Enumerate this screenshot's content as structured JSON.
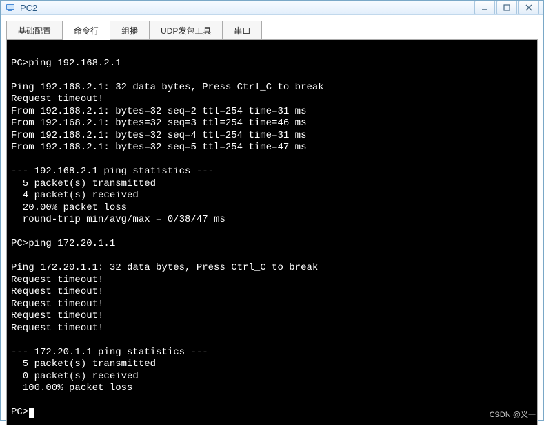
{
  "window": {
    "title": "PC2"
  },
  "tabs": [
    {
      "label": "基础配置",
      "active": false
    },
    {
      "label": "命令行",
      "active": true
    },
    {
      "label": "组播",
      "active": false
    },
    {
      "label": "UDP发包工具",
      "active": false
    },
    {
      "label": "串口",
      "active": false
    }
  ],
  "terminal": {
    "lines": [
      "",
      "PC>ping 192.168.2.1",
      "",
      "Ping 192.168.2.1: 32 data bytes, Press Ctrl_C to break",
      "Request timeout!",
      "From 192.168.2.1: bytes=32 seq=2 ttl=254 time=31 ms",
      "From 192.168.2.1: bytes=32 seq=3 ttl=254 time=46 ms",
      "From 192.168.2.1: bytes=32 seq=4 ttl=254 time=31 ms",
      "From 192.168.2.1: bytes=32 seq=5 ttl=254 time=47 ms",
      "",
      "--- 192.168.2.1 ping statistics ---",
      "  5 packet(s) transmitted",
      "  4 packet(s) received",
      "  20.00% packet loss",
      "  round-trip min/avg/max = 0/38/47 ms",
      "",
      "PC>ping 172.20.1.1",
      "",
      "Ping 172.20.1.1: 32 data bytes, Press Ctrl_C to break",
      "Request timeout!",
      "Request timeout!",
      "Request timeout!",
      "Request timeout!",
      "Request timeout!",
      "",
      "--- 172.20.1.1 ping statistics ---",
      "  5 packet(s) transmitted",
      "  0 packet(s) received",
      "  100.00% packet loss",
      "",
      "PC>"
    ]
  },
  "watermark": "CSDN @义一"
}
